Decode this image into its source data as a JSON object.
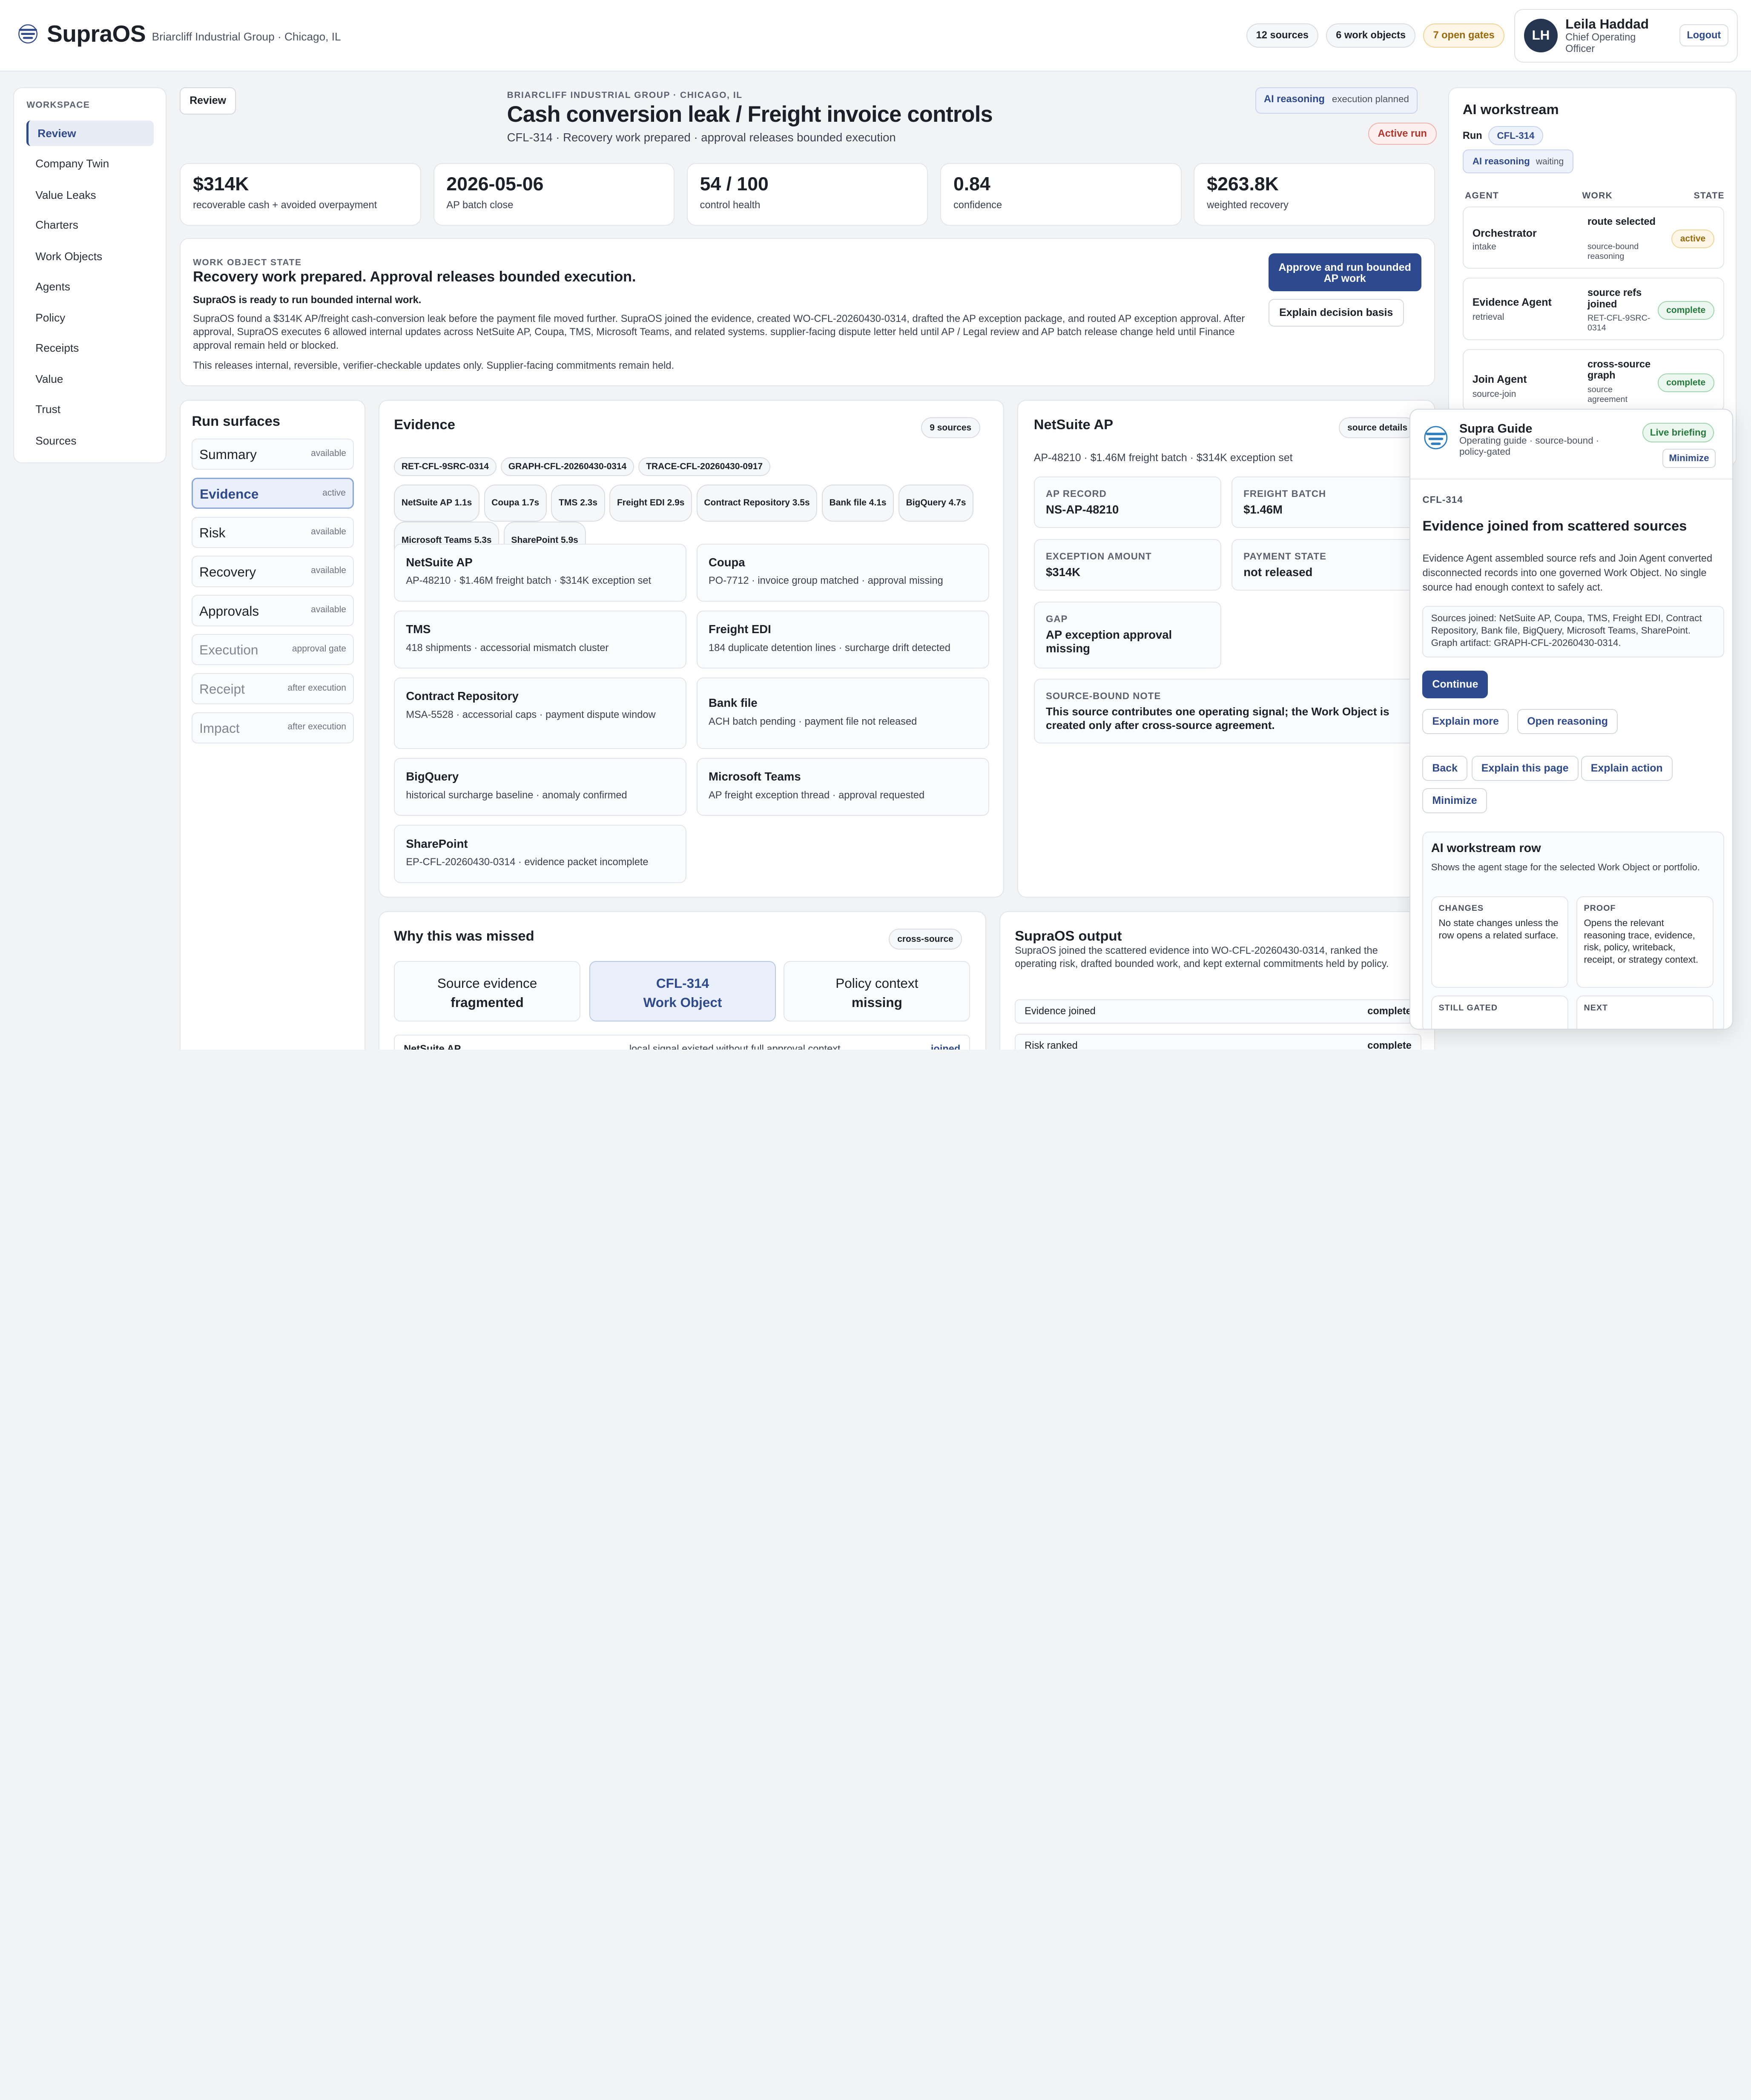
{
  "header": {
    "brand": "SupraOS",
    "org": "Briarcliff Industrial Group · Chicago, IL",
    "pills": [
      "12 sources",
      "6 work objects",
      "7 open gates"
    ],
    "user": {
      "initials": "LH",
      "name": "Leila Haddad",
      "role": "Chief Operating Officer",
      "logout": "Logout"
    }
  },
  "nav": {
    "heading": "WORKSPACE",
    "items": [
      "Review",
      "Company Twin",
      "Value Leaks",
      "Charters",
      "Work Objects",
      "Agents",
      "Policy",
      "Receipts",
      "Value",
      "Trust",
      "Sources"
    ]
  },
  "review_btn": "Review",
  "title": {
    "eyebrow": "BRIARCLIFF INDUSTRIAL GROUP · CHICAGO, IL",
    "main": "Cash conversion leak / Freight invoice controls",
    "sub": "CFL-314 · Recovery work prepared · approval releases bounded execution",
    "ai_label": "AI reasoning",
    "ai_state": "execution planned",
    "run_badge": "Active run"
  },
  "kpis": [
    {
      "value": "$314K",
      "label": "recoverable cash + avoided overpayment"
    },
    {
      "value": "2026-05-06",
      "label": "AP batch close"
    },
    {
      "value": "54 / 100",
      "label": "control health"
    },
    {
      "value": "0.84",
      "label": "confidence"
    },
    {
      "value": "$263.8K",
      "label": "weighted recovery"
    }
  ],
  "state": {
    "eyebrow": "WORK OBJECT STATE",
    "headline": "Recovery work prepared. Approval releases bounded execution.",
    "ready": "SupraOS is ready to run bounded internal work.",
    "body": "SupraOS found a $314K AP/freight cash-conversion leak before the payment file moved further. SupraOS joined the evidence, created WO-CFL-20260430-0314, drafted the AP exception package, and routed AP exception approval. After approval, SupraOS executes 6 allowed internal updates across NetSuite AP, Coupa, TMS, Microsoft Teams, and related systems. supplier-facing dispute letter held until AP / Legal review and AP batch release change held until Finance approval remain held or blocked.",
    "note": "This releases internal, reversible, verifier-checkable updates only. Supplier-facing commitments remain held.",
    "approve": "Approve and run bounded AP work",
    "explain": "Explain decision basis"
  },
  "surfaces": {
    "title": "Run surfaces",
    "items": [
      {
        "name": "Summary",
        "status": "available"
      },
      {
        "name": "Evidence",
        "status": "active"
      },
      {
        "name": "Risk",
        "status": "available"
      },
      {
        "name": "Recovery",
        "status": "available"
      },
      {
        "name": "Approvals",
        "status": "available"
      },
      {
        "name": "Execution",
        "status": "approval gate"
      },
      {
        "name": "Receipt",
        "status": "after execution"
      },
      {
        "name": "Impact",
        "status": "after execution"
      }
    ]
  },
  "evidence": {
    "title": "Evidence",
    "count": "9 sources",
    "refs": [
      "RET-CFL-9SRC-0314",
      "GRAPH-CFL-20260430-0314",
      "TRACE-CFL-20260430-0917"
    ],
    "timings": [
      "NetSuite AP 1.1s",
      "Coupa 1.7s",
      "TMS 2.3s",
      "Freight EDI 2.9s",
      "Contract Repository 3.5s",
      "Bank file 4.1s",
      "BigQuery 4.7s",
      "Microsoft Teams 5.3s",
      "SharePoint 5.9s"
    ],
    "sources": [
      {
        "t": "NetSuite AP",
        "d": "AP-48210 · $1.46M freight batch · $314K exception set"
      },
      {
        "t": "Coupa",
        "d": "PO-7712 · invoice group matched · approval missing"
      },
      {
        "t": "TMS",
        "d": "418 shipments · accessorial mismatch cluster"
      },
      {
        "t": "Freight EDI",
        "d": "184 duplicate detention lines · surcharge drift detected"
      },
      {
        "t": "Contract Repository",
        "d": "MSA-5528 · accessorial caps · payment dispute window"
      },
      {
        "t": "Bank file",
        "d": "ACH batch pending · payment file not released"
      },
      {
        "t": "BigQuery",
        "d": "historical surcharge baseline · anomaly confirmed"
      },
      {
        "t": "Microsoft Teams",
        "d": "AP freight exception thread · approval requested"
      },
      {
        "t": "SharePoint",
        "d": "EP-CFL-20260430-0314 · evidence packet incomplete"
      }
    ]
  },
  "netsuite": {
    "title": "NetSuite AP",
    "btn": "source details",
    "sub": "AP-48210 · $1.46M freight batch · $314K exception set",
    "fields": [
      {
        "k": "AP RECORD",
        "v": "NS-AP-48210"
      },
      {
        "k": "FREIGHT BATCH",
        "v": "$1.46M"
      },
      {
        "k": "EXCEPTION AMOUNT",
        "v": "$314K"
      },
      {
        "k": "PAYMENT STATE",
        "v": "not released"
      },
      {
        "k": "GAP",
        "v": "AP exception approval missing"
      }
    ],
    "note_k": "SOURCE-BOUND NOTE",
    "note_v": "This source contributes one operating signal; the Work Object is created only after cross-source agreement."
  },
  "missed": {
    "title": "Why this was missed",
    "badge": "cross-source",
    "tabs": [
      {
        "a": "Source evidence",
        "b": "fragmented"
      },
      {
        "a": "CFL-314",
        "b": "Work Object"
      },
      {
        "a": "Policy context",
        "b": "missing"
      }
    ],
    "row": {
      "a": "NetSuite AP",
      "b": "local signal existed without full approval context",
      "c": "joined"
    }
  },
  "output": {
    "title": "SupraOS output",
    "body": "SupraOS joined the scattered evidence into WO-CFL-20260430-0314, ranked the operating risk, drafted bounded work, and kept external commitments held by policy.",
    "rows": [
      {
        "a": "Evidence joined",
        "b": "complete"
      },
      {
        "a": "Risk ranked",
        "b": "complete"
      }
    ]
  },
  "workstream": {
    "title": "AI workstream",
    "run_label": "Run",
    "run": "CFL-314",
    "ai_label": "AI reasoning",
    "ai_state": "waiting",
    "cols": [
      "AGENT",
      "WORK",
      "STATE"
    ],
    "agents": [
      {
        "name": "Orchestrator",
        "role": "intake",
        "work": "route selected",
        "detail": "source-bound reasoning",
        "state": "active"
      },
      {
        "name": "Evidence Agent",
        "role": "retrieval",
        "work": "source refs joined",
        "detail": "RET-CFL-9SRC-0314",
        "state": "complete"
      },
      {
        "name": "Join Agent",
        "role": "source-join",
        "work": "cross-source graph",
        "detail": "source agreement",
        "state": "complete"
      }
    ]
  },
  "guide": {
    "title": "Supra Guide",
    "sub": "Operating guide · source-bound · policy-gated",
    "live": "Live briefing",
    "minimize": "Minimize",
    "id": "CFL-314",
    "headline": "Evidence joined from scattered sources",
    "body": "Evidence Agent assembled source refs and Join Agent converted disconnected records into one governed Work Object. No single source had enough context to safely act.",
    "sources": "Sources joined: NetSuite AP, Coupa, TMS, Freight EDI, Contract Repository, Bank file, BigQuery, Microsoft Teams, SharePoint. Graph artifact: GRAPH-CFL-20260430-0314.",
    "continue": "Continue",
    "actions": [
      "Explain more",
      "Open reasoning",
      "Back",
      "Explain this page",
      "Explain action",
      "Minimize"
    ],
    "row_title": "AI workstream row",
    "row_desc": "Shows the agent stage for the selected Work Object or portfolio.",
    "boxes": [
      {
        "k": "CHANGES",
        "v": "No state changes unless the row opens a related surface."
      },
      {
        "k": "PROOF",
        "v": "Opens the relevant reasoning trace, evidence, risk, policy, writeback, receipt, or strategy context."
      },
      {
        "k": "STILL GATED",
        "v": ""
      },
      {
        "k": "NEXT",
        "v": ""
      }
    ]
  }
}
